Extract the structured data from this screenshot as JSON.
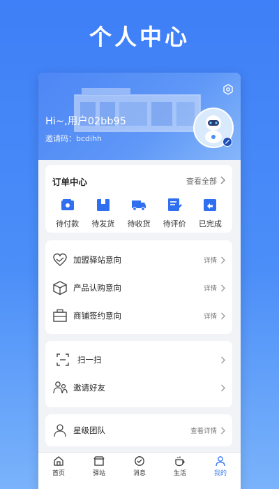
{
  "page_title": "个人中心",
  "profile": {
    "greeting": "Hi~,用户02bb95",
    "invite_code": "邀请码：bcdihh"
  },
  "orders": {
    "title": "订单中心",
    "view_all": "查看全部",
    "items": [
      {
        "label": "待付款",
        "icon": "wallet-icon"
      },
      {
        "label": "待发货",
        "icon": "package-icon"
      },
      {
        "label": "待收货",
        "icon": "truck-icon"
      },
      {
        "label": "待评价",
        "icon": "review-icon"
      },
      {
        "label": "已完成",
        "icon": "return-box-icon"
      }
    ]
  },
  "intents": [
    {
      "label": "加盟驿站意向",
      "detail": "详情",
      "icon": "handshake-heart-icon"
    },
    {
      "label": "产品认购意向",
      "detail": "详情",
      "icon": "box-icon"
    },
    {
      "label": "商铺签约意向",
      "detail": "详情",
      "icon": "shop-icon"
    }
  ],
  "tools": [
    {
      "label": "扫一扫",
      "icon": "scan-icon"
    },
    {
      "label": "邀请好友",
      "icon": "invite-friends-icon"
    }
  ],
  "team": {
    "label": "星级团队",
    "detail": "查看详情",
    "icon": "team-icon"
  },
  "tabbar": [
    {
      "label": "首页",
      "icon": "home-icon"
    },
    {
      "label": "驿站",
      "icon": "station-icon"
    },
    {
      "label": "消息",
      "icon": "message-icon"
    },
    {
      "label": "生活",
      "icon": "coffee-icon"
    },
    {
      "label": "我的",
      "icon": "profile-icon",
      "active": true
    }
  ],
  "colors": {
    "accent": "#3f7ff7",
    "icon_blue": "#2f6ff0"
  }
}
